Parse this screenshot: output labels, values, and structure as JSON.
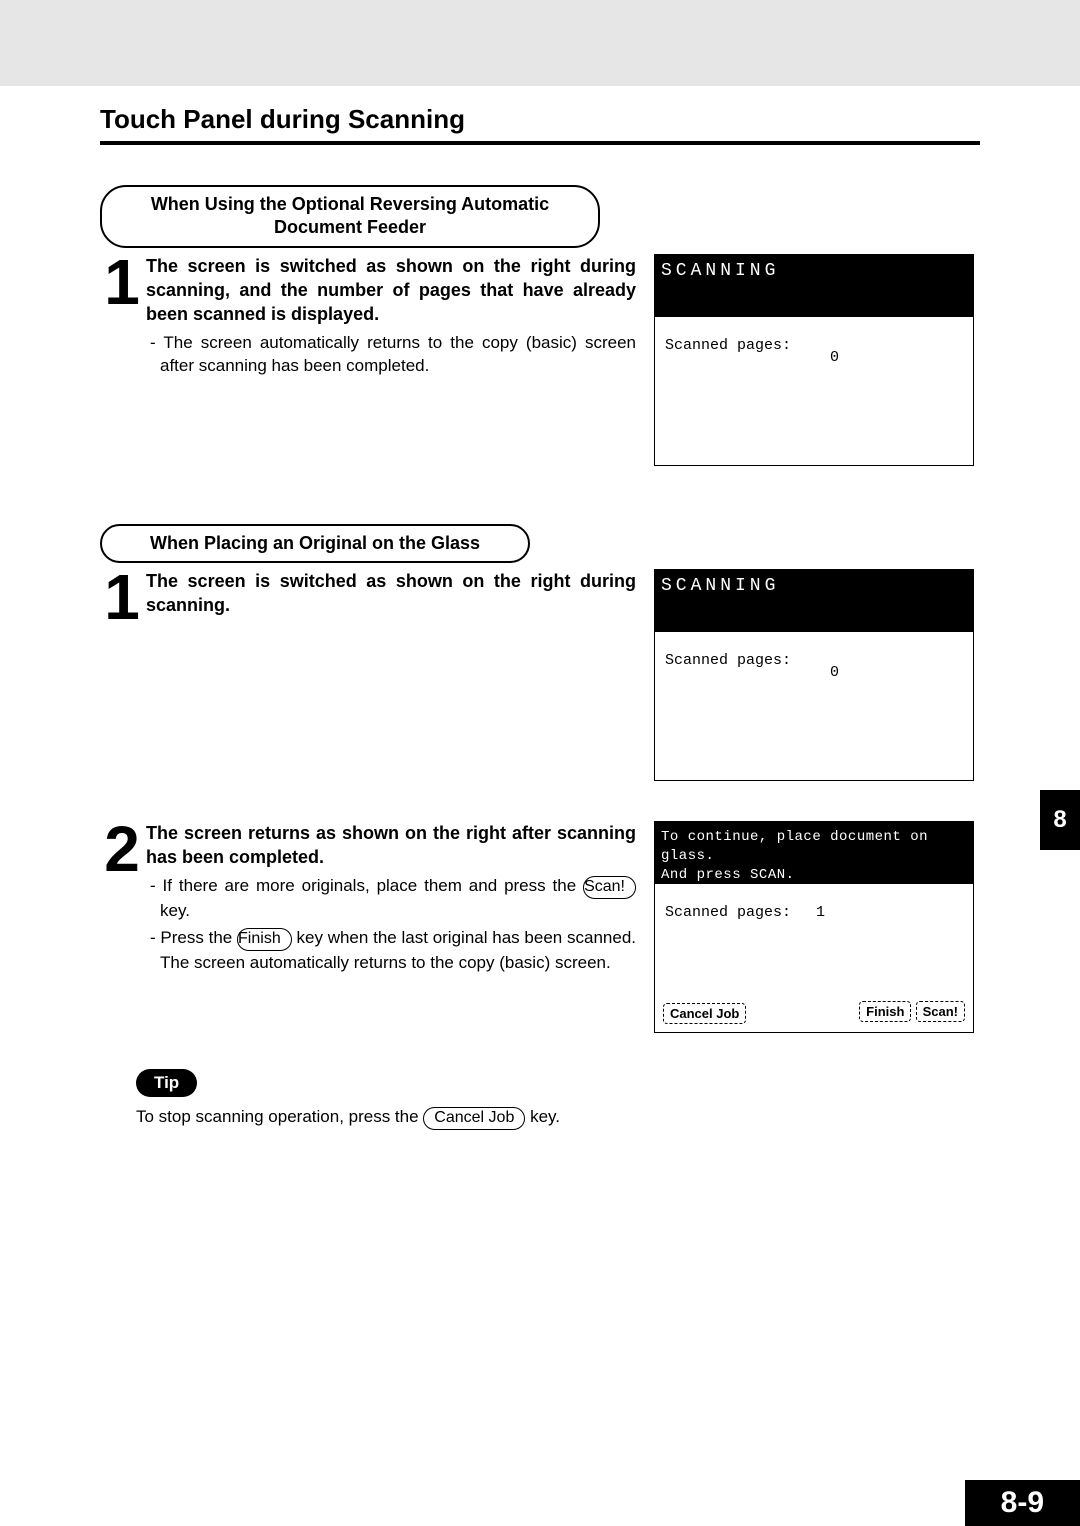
{
  "title": "Touch Panel during Scanning",
  "chapter_tab": "8",
  "page_number": "8-9",
  "section1": {
    "pill": "When Using the Optional Reversing Automatic Document Feeder",
    "step1_num": "1",
    "step1_bold": "The screen is switched as shown on the right during scanning, and the number of pages that have already been scanned is displayed.",
    "step1_sub": "- The screen automatically returns to the copy (basic) screen after scanning has been completed.",
    "panel": {
      "header": "SCANNING",
      "label": "Scanned pages:",
      "count": "0"
    }
  },
  "section2": {
    "pill": "When Placing an Original on the Glass",
    "step1_num": "1",
    "step1_bold": "The screen is switched as shown on the right during scanning.",
    "panel1": {
      "header": "SCANNING",
      "label": "Scanned pages:",
      "count": "0"
    },
    "step2_num": "2",
    "step2_bold": "The screen returns as shown on the right after scanning has been completed.",
    "step2_sub1a": "- If there are more originals, place them and press the ",
    "step2_sub1_key": "Scan!",
    "step2_sub1b": " key.",
    "step2_sub2a": "- Press the ",
    "step2_sub2_key": "Finish",
    "step2_sub2b": " key when the last original has been scanned. The screen automatically returns to the copy (basic) screen.",
    "panel2": {
      "msg1": "To continue, place document on glass.",
      "msg2": "And press SCAN.",
      "label": "Scanned pages:",
      "count": "1",
      "btn_cancel": "Cancel Job",
      "btn_finish": "Finish",
      "btn_scan": "Scan!"
    }
  },
  "tip": {
    "badge": "Tip",
    "text_a": "To stop scanning operation, press the ",
    "key": "Cancel Job",
    "text_b": " key."
  }
}
